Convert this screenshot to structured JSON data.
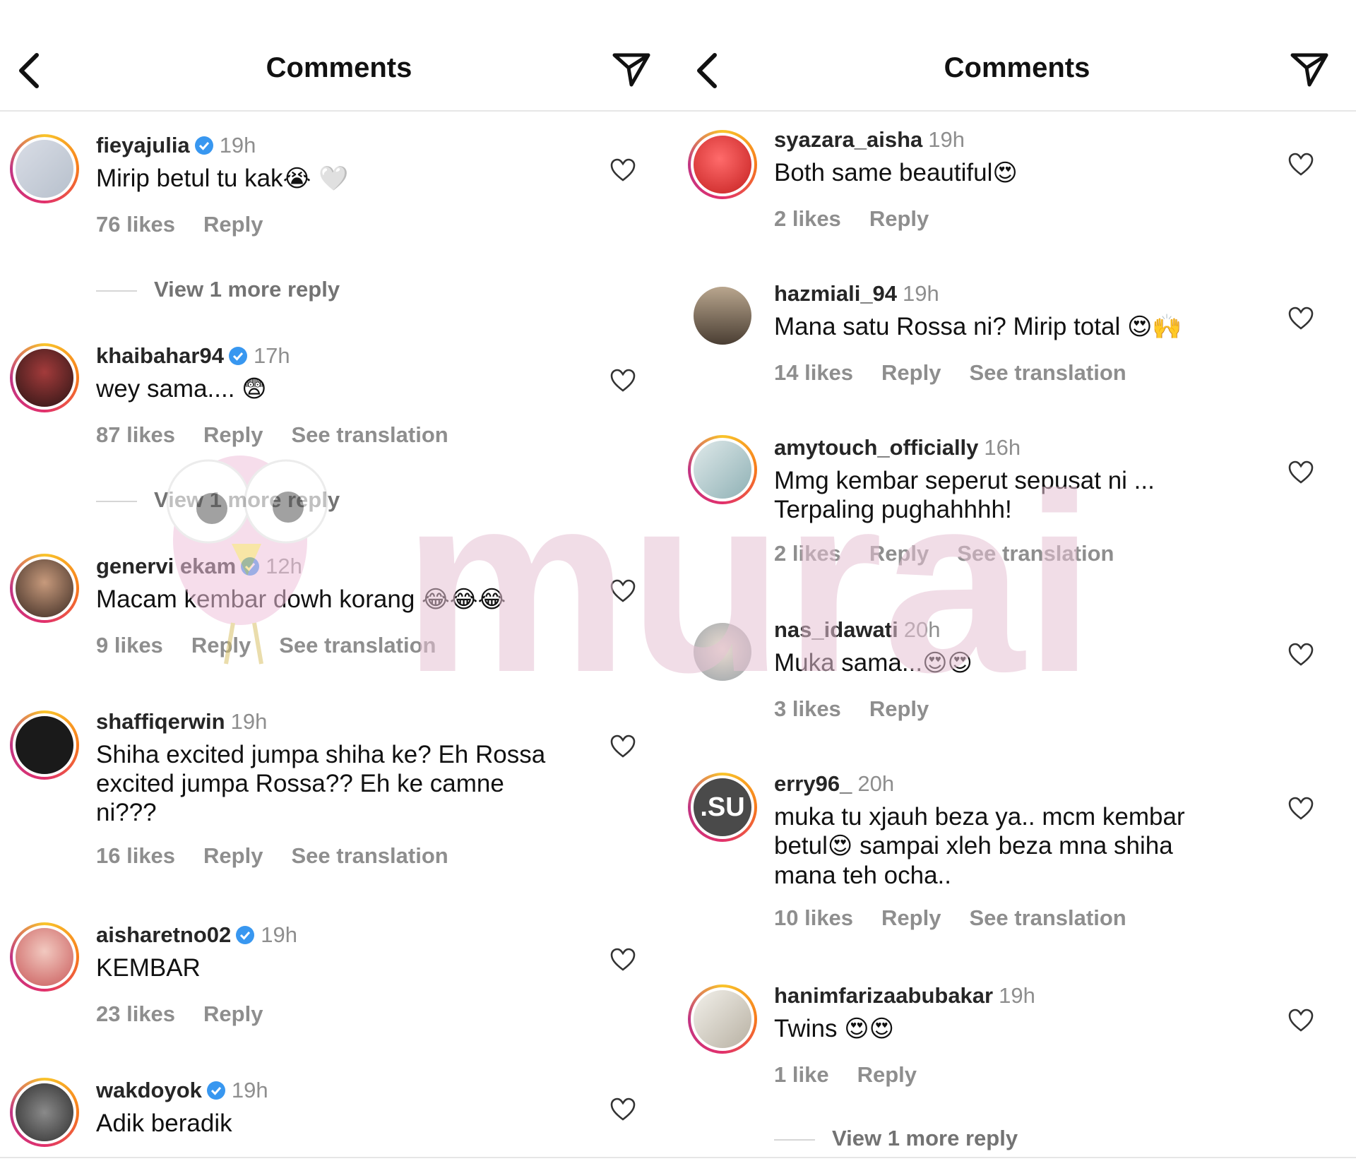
{
  "left": {
    "title": "Comments",
    "comments": [
      {
        "user": "fieyajulia",
        "verified": true,
        "time": "19h",
        "text": "Mirip betul tu kak",
        "emoji": "😭 🤍",
        "likes": "76 likes",
        "reply": "Reply",
        "view_more": "View 1 more reply"
      },
      {
        "user": "khaibahar94",
        "verified": true,
        "time": "17h",
        "text": "wey sama.... ",
        "emoji": "😨",
        "likes": "87 likes",
        "reply": "Reply",
        "see_translation": "See translation",
        "view_more": "View 1 more reply"
      },
      {
        "user": "genervi ekam",
        "verified": true,
        "time": "12h",
        "text": "Macam kembar dowh korang ",
        "emoji": "😂😂😂",
        "likes": "9 likes",
        "reply": "Reply",
        "see_translation": "See translation"
      },
      {
        "user": "shaffiqerwin",
        "verified": false,
        "time": "19h",
        "text": "Shiha excited jumpa shiha ke? Eh Rossa excited jumpa Rossa?? Eh ke camne ni???",
        "likes": "16 likes",
        "reply": "Reply",
        "see_translation": "See translation"
      },
      {
        "user": "aisharetno02",
        "verified": true,
        "time": "19h",
        "text": "KEMBAR",
        "likes": "23 likes",
        "reply": "Reply"
      },
      {
        "user": "wakdoyok",
        "verified": true,
        "time": "19h",
        "text": "Adik beradik"
      }
    ]
  },
  "right": {
    "title": "Comments",
    "comments": [
      {
        "user": "syazara_aisha",
        "time": "19h",
        "text": "Both same beautiful",
        "emoji": "😍",
        "likes": "2 likes",
        "reply": "Reply"
      },
      {
        "user": "hazmiali_94",
        "time": "19h",
        "text": "Mana satu Rossa ni? Mirip total ",
        "emoji": "😍🙌",
        "likes": "14 likes",
        "reply": "Reply",
        "see_translation": "See translation"
      },
      {
        "user": "amytouch_officially",
        "time": "16h",
        "text": "Mmg  kembar  seperut sepusat ni ... Terpaling pughahhhh!",
        "likes": "2 likes",
        "reply": "Reply",
        "see_translation": "See translation"
      },
      {
        "user": "nas_idawati",
        "time": "20h",
        "text": "Muka sama...",
        "emoji": "😍😍",
        "likes": "3 likes",
        "reply": "Reply"
      },
      {
        "user": "erry96_",
        "time": "20h",
        "text_a": "muka tu xjauh beza ya.. mcm kembar betul",
        "emoji": "😍",
        "text_b": " sampai xleh beza mna shiha mana teh ocha..",
        "likes": "10 likes",
        "reply": "Reply",
        "see_translation": "See translation",
        "avatar_text": ".SU"
      },
      {
        "user": "hanimfarizaabubakar",
        "time": "19h",
        "text": "Twins ",
        "emoji": "😍😍",
        "likes": "1 like",
        "reply": "Reply",
        "view_more": "View 1 more reply"
      }
    ]
  },
  "watermark": "murai",
  "colors": {
    "meta": "#8e8e8e",
    "verified": "#3897f0",
    "ring": "#e1306c",
    "watermark": "#e8c6d6"
  },
  "icons": [
    "back-arrow-icon",
    "send-icon",
    "verified-badge-icon",
    "heart-icon"
  ]
}
